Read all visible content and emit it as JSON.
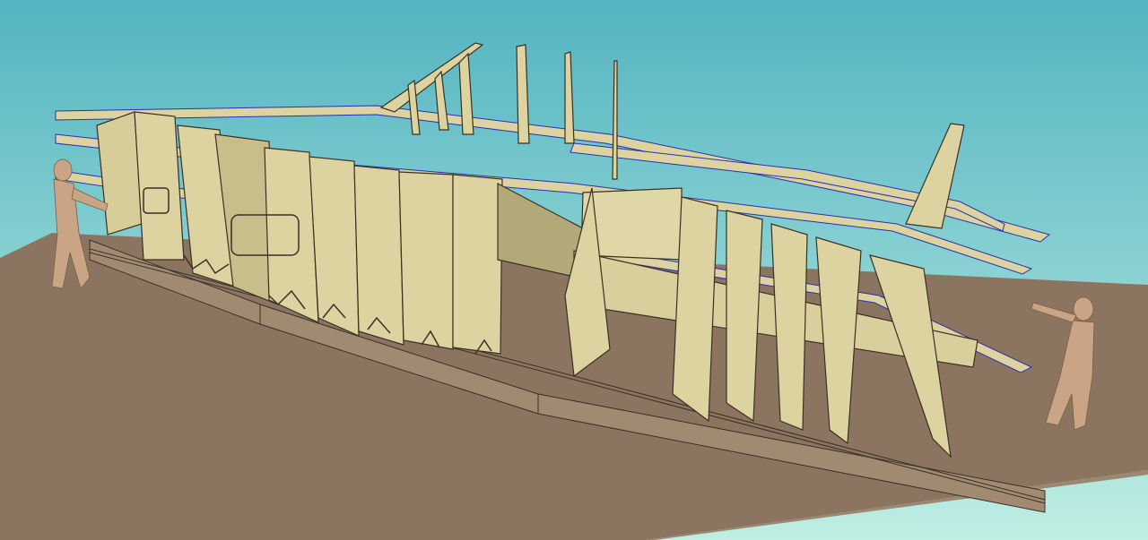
{
  "scene": {
    "colors": {
      "sky_top": "#53b4c1",
      "sky_bottom": "#bfeee3",
      "base_top": "#8b7560",
      "base_side": "#9c8770",
      "frame_fill": "#ddd3a0",
      "frame_fill_dark": "#c8be8c",
      "frame_edge": "#2a2fb0",
      "outline": "#3a3024",
      "figure": "#c9a585"
    },
    "objects": [
      "build-base",
      "keel-rail",
      "hull-frames",
      "longitudinal-stringers",
      "rudder-fins",
      "human-figure-left",
      "human-figure-right"
    ]
  }
}
